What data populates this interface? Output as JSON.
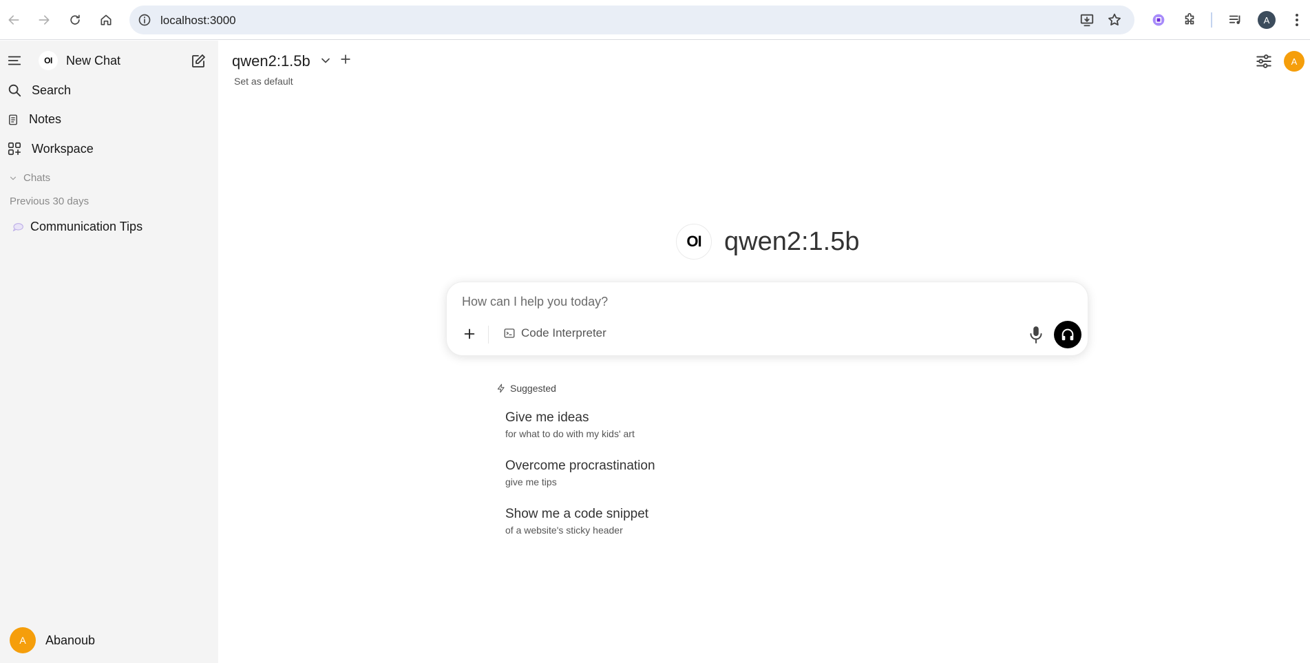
{
  "browser": {
    "url": "localhost:3000",
    "profile_initial": "A"
  },
  "sidebar": {
    "brand_logo": "OI",
    "new_chat_label": "New Chat",
    "items": [
      {
        "label": "Search",
        "icon": "search-icon"
      },
      {
        "label": "Notes",
        "icon": "notes-icon"
      },
      {
        "label": "Workspace",
        "icon": "workspace-icon"
      }
    ],
    "chats_section": "Chats",
    "period": "Previous 30 days",
    "chats": [
      {
        "label": "Communication Tips",
        "icon": "chat-bubble-icon"
      }
    ],
    "user": {
      "initial": "A",
      "name": "Abanoub"
    }
  },
  "main": {
    "model_name": "qwen2:1.5b",
    "set_default": "Set as default",
    "avatar_initial": "A",
    "hero_logo": "OI",
    "hero_title": "qwen2:1.5b",
    "composer": {
      "placeholder": "How can I help you today?",
      "tool_label": "Code Interpreter"
    },
    "suggested_label": "Suggested",
    "suggestions": [
      {
        "title": "Give me ideas",
        "subtitle": "for what to do with my kids' art"
      },
      {
        "title": "Overcome procrastination",
        "subtitle": "give me tips"
      },
      {
        "title": "Show me a code snippet",
        "subtitle": "of a website's sticky header"
      }
    ]
  },
  "colors": {
    "accent_avatar": "#f59e0b",
    "sidebar_bg": "#f4f4f4",
    "omnibox_bg": "#e9eef6"
  }
}
